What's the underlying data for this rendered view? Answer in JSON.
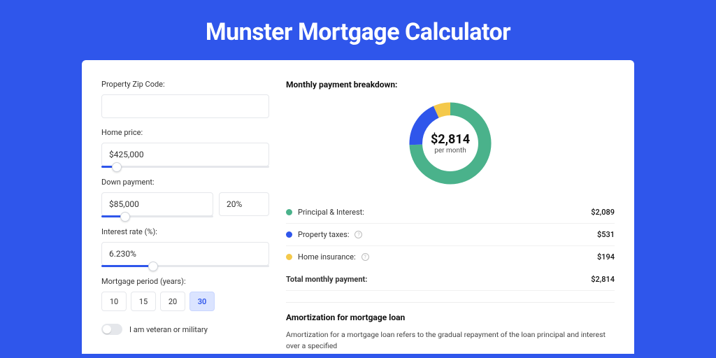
{
  "title": "Munster Mortgage Calculator",
  "colors": {
    "principal": "#4ab28b",
    "taxes": "#2f56eb",
    "insurance": "#f4c94b"
  },
  "form": {
    "zip": {
      "label": "Property Zip Code:",
      "value": ""
    },
    "home_price": {
      "label": "Home price:",
      "value": "$425,000",
      "slider_pct": 9
    },
    "down_payment": {
      "label": "Down payment:",
      "amount": "$85,000",
      "pct_value": "20%",
      "slider_pct": 21
    },
    "interest_rate": {
      "label": "Interest rate (%):",
      "value": "6.230%",
      "slider_pct": 31
    },
    "mortgage_period": {
      "label": "Mortgage period (years):",
      "options": [
        "10",
        "15",
        "20",
        "30"
      ],
      "active": "30"
    },
    "veteran": {
      "label": "I am veteran or military",
      "checked": false
    }
  },
  "breakdown": {
    "title": "Monthly payment breakdown:",
    "center_amount": "$2,814",
    "center_sub": "per month",
    "items": [
      {
        "label": "Principal & Interest:",
        "value": "$2,089",
        "color_key": "principal",
        "info": false
      },
      {
        "label": "Property taxes:",
        "value": "$531",
        "color_key": "taxes",
        "info": true
      },
      {
        "label": "Home insurance:",
        "value": "$194",
        "color_key": "insurance",
        "info": true
      }
    ],
    "total_label": "Total monthly payment:",
    "total_value": "$2,814"
  },
  "chart_data": {
    "type": "pie",
    "title": "Monthly payment breakdown",
    "categories": [
      "Principal & Interest",
      "Property taxes",
      "Home insurance"
    ],
    "values": [
      2089,
      531,
      194
    ],
    "total": 2814,
    "colors": [
      "#4ab28b",
      "#2f56eb",
      "#f4c94b"
    ]
  },
  "amortization": {
    "title": "Amortization for mortgage loan",
    "text": "Amortization for a mortgage loan refers to the gradual repayment of the loan principal and interest over a specified"
  }
}
